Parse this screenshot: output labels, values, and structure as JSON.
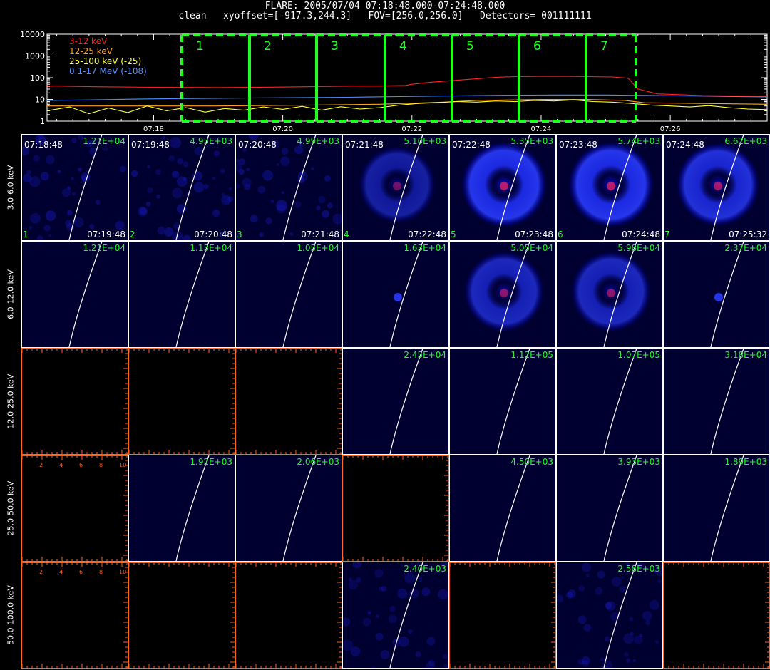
{
  "header": {
    "line1": "FLARE: 2005/07/04 07:18:48.000-07:24:48.000",
    "line2": "clean   xyoffset=[-917.3,244.3]   FOV=[256.0,256.0]   Detectors= 001111111"
  },
  "chart_data": [
    {
      "type": "line",
      "y_scale": "log",
      "ylim": [
        1,
        10000
      ],
      "y_ticks": [
        "1",
        "10",
        "100",
        "1000",
        "10000"
      ],
      "x_ticks": [
        "07:18",
        "07:20",
        "07:22",
        "07:24",
        "07:26"
      ],
      "x_tick_minutes": [
        18,
        20,
        22,
        24,
        26
      ],
      "x_range_minutes": [
        16.35,
        27.5
      ],
      "legend_placement": "top-left",
      "series": [
        {
          "name": "3-12 keV",
          "color": "#ff2020",
          "x": [
            16.35,
            17.2,
            18.0,
            19.0,
            20.0,
            20.8,
            21.5,
            21.9,
            22.0,
            22.3,
            22.9,
            23.3,
            23.6,
            24.0,
            24.4,
            24.7,
            25.1,
            25.35,
            25.5,
            25.8,
            26.5,
            27.5
          ],
          "y": [
            42,
            38,
            36,
            35,
            37,
            40,
            42,
            44,
            50,
            62,
            85,
            105,
            112,
            115,
            115,
            112,
            108,
            95,
            30,
            18,
            15,
            14
          ]
        },
        {
          "name": "12-25 keV",
          "color": "#ffa020",
          "x": [
            16.35,
            17.5,
            19.0,
            20.5,
            21.5,
            22.5,
            23.0,
            24.0,
            24.7,
            25.3,
            25.6,
            26.5,
            27.5
          ],
          "y": [
            5,
            5,
            5,
            5.5,
            6,
            7.5,
            9,
            10,
            10,
            9,
            7,
            6.5,
            6
          ]
        },
        {
          "name": "25-100 keV (-25)",
          "color": "#ffff30",
          "x": [
            16.35,
            16.7,
            17.0,
            17.3,
            17.6,
            17.9,
            18.2,
            18.5,
            18.8,
            19.1,
            19.4,
            19.7,
            20.0,
            20.3,
            20.6,
            20.9,
            21.2,
            21.5,
            21.8,
            22.1,
            22.4,
            22.7,
            23.0,
            23.3,
            23.6,
            23.9,
            24.2,
            24.5,
            24.8,
            25.1,
            25.4,
            25.7,
            26.0,
            26.3,
            26.6,
            26.9,
            27.2,
            27.5
          ],
          "y": [
            3,
            4.5,
            2.2,
            4,
            2.5,
            5,
            3,
            4.2,
            2.6,
            3.8,
            3.2,
            4.5,
            3.5,
            4.8,
            3.2,
            4.6,
            3.6,
            4.2,
            5.5,
            6.5,
            7.2,
            8,
            7.5,
            8.5,
            8,
            9,
            8.5,
            9.5,
            8,
            7.5,
            6.5,
            5.5,
            5,
            4.5,
            5.2,
            4.2,
            3.6,
            3.4
          ]
        },
        {
          "name": "0.1-17 MeV (-108)",
          "color": "#4d8fff",
          "x": [
            16.35,
            17.0,
            17.8,
            18.6,
            19.4,
            20.2,
            21.0,
            21.8,
            22.6,
            23.4,
            24.2,
            25.0,
            25.8,
            26.6,
            27.5
          ],
          "y": [
            9,
            9.5,
            10.5,
            11,
            11.5,
            12,
            12.5,
            13.5,
            14.5,
            15.5,
            16,
            16,
            15,
            14,
            13
          ]
        }
      ]
    }
  ],
  "intervals": [
    {
      "label": "1"
    },
    {
      "label": "2"
    },
    {
      "label": "3"
    },
    {
      "label": "4"
    },
    {
      "label": "5"
    },
    {
      "label": "6"
    },
    {
      "label": "7"
    }
  ],
  "energy_bands": [
    "3.0-6.0 keV",
    "6.0-12.0 keV",
    "12.0-25.0 keV",
    "25.0-50.0 keV",
    "50.0-100.0 keV"
  ],
  "row1_times": {
    "start": [
      "07:18:48",
      "07:19:48",
      "07:20:48",
      "07:21:48",
      "07:22:48",
      "07:23:48",
      "07:24:48"
    ],
    "end": [
      "07:19:48",
      "07:20:48",
      "07:21:48",
      "07:22:48",
      "07:23:48",
      "07:24:48",
      "07:25:32"
    ]
  },
  "panels": [
    [
      {
        "flux": "1.21E+04",
        "style": "speckle",
        "intensity": 0.35
      },
      {
        "flux": "4.95E+03",
        "style": "speckle",
        "intensity": 0.35
      },
      {
        "flux": "4.99E+03",
        "style": "speckle",
        "intensity": 0.35
      },
      {
        "flux": "5.10E+03",
        "style": "halo",
        "intensity": 0.6
      },
      {
        "flux": "5.35E+03",
        "style": "halo",
        "intensity": 1.0
      },
      {
        "flux": "5.74E+03",
        "style": "halo",
        "intensity": 1.0
      },
      {
        "flux": "6.62E+03",
        "style": "halo",
        "intensity": 0.9
      }
    ],
    [
      {
        "flux": "1.21E+04",
        "style": "plain"
      },
      {
        "flux": "1.13E+04",
        "style": "plain"
      },
      {
        "flux": "1.05E+04",
        "style": "plain"
      },
      {
        "flux": "1.63E+04",
        "style": "dot"
      },
      {
        "flux": "5.05E+04",
        "style": "halo",
        "intensity": 0.75
      },
      {
        "flux": "5.98E+04",
        "style": "halo",
        "intensity": 0.75
      },
      {
        "flux": "2.37E+04",
        "style": "dot"
      }
    ],
    [
      {
        "style": "empty"
      },
      {
        "style": "empty"
      },
      {
        "style": "empty"
      },
      {
        "flux": "2.45E+04",
        "style": "plain"
      },
      {
        "flux": "1.12E+05",
        "style": "plain"
      },
      {
        "flux": "1.07E+05",
        "style": "plain"
      },
      {
        "flux": "3.18E+04",
        "style": "plain"
      }
    ],
    [
      {
        "style": "empty"
      },
      {
        "flux": "1.92E+03",
        "style": "plain"
      },
      {
        "flux": "2.06E+03",
        "style": "plain"
      },
      {
        "style": "empty"
      },
      {
        "flux": "4.50E+03",
        "style": "plain"
      },
      {
        "flux": "3.93E+03",
        "style": "plain"
      },
      {
        "flux": "1.89E+03",
        "style": "plain"
      }
    ],
    [
      {
        "style": "empty"
      },
      {
        "style": "empty"
      },
      {
        "style": "empty"
      },
      {
        "flux": "2.40E+03",
        "style": "speckle",
        "intensity": 0.25
      },
      {
        "style": "empty"
      },
      {
        "flux": "2.58E+03",
        "style": "speckle",
        "intensity": 0.25
      },
      {
        "style": "empty"
      }
    ]
  ],
  "empty_axis_ticks": [
    "2",
    "4",
    "6",
    "8",
    "10"
  ]
}
